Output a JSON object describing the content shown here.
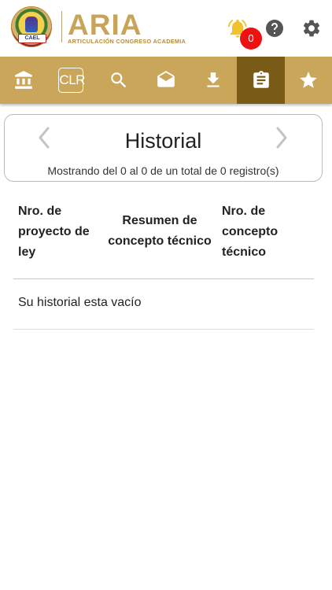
{
  "header": {
    "seal_label": "CAEL",
    "logo_text": "ARIA",
    "logo_subtitle": "ARTICULACIÓN CONGRESO ACADEMIA",
    "notifications_count": "0"
  },
  "toolbar": {
    "items": [
      {
        "icon": "bank-icon"
      },
      {
        "icon": "clr-icon",
        "label": "CLR"
      },
      {
        "icon": "search-icon"
      },
      {
        "icon": "mail-open-icon"
      },
      {
        "icon": "download-icon"
      },
      {
        "icon": "clipboard-icon",
        "active": true
      },
      {
        "icon": "star-icon"
      }
    ],
    "colors": {
      "background": "#c9a65a",
      "active": "#7a5a17"
    }
  },
  "historial": {
    "title": "Historial",
    "info": "Mostrando del 0 al 0 de un total de 0 registro(s)"
  },
  "table": {
    "columns": [
      "Nro. de proyecto de ley",
      "Resumen de concepto técnico",
      "Nro. de concepto técnico"
    ],
    "empty_message": "Su historial esta vacío"
  }
}
